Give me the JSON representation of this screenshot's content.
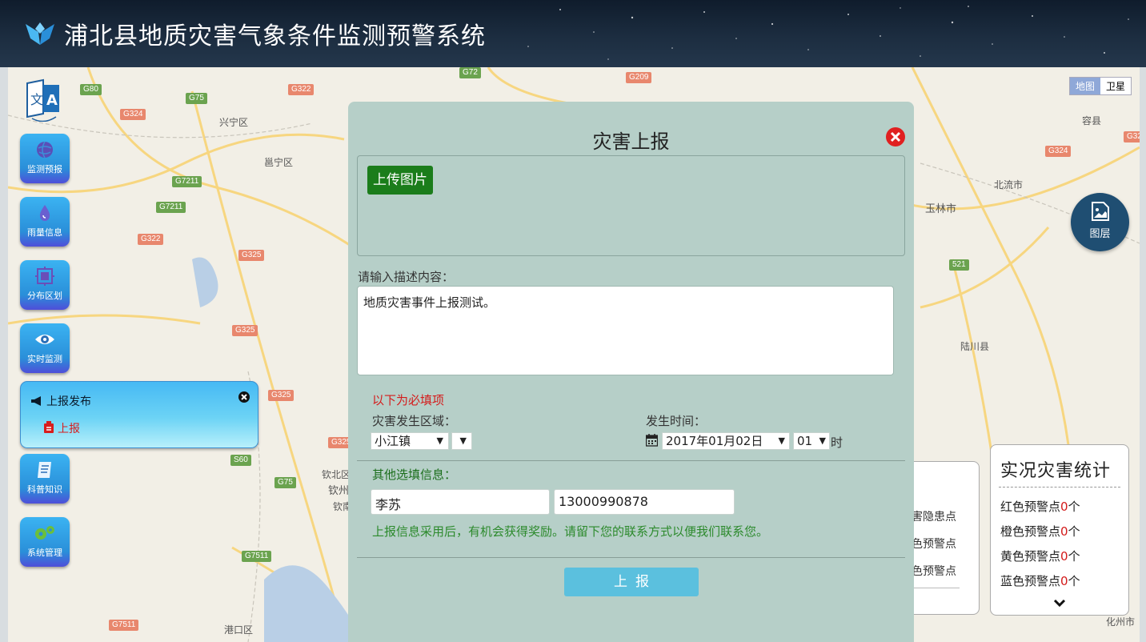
{
  "header": {
    "title": "浦北县地质灾害气象条件监测预警系统"
  },
  "map_type": {
    "map": "地图",
    "satellite": "卫星"
  },
  "map_labels": {
    "places": [
      "兴宁区",
      "邕宁区",
      "玉林市",
      "北流市",
      "容县",
      "陆川县",
      "钦北区",
      "钦州",
      "港口区",
      "化州市",
      "钦南"
    ],
    "roads": [
      "G80",
      "G75",
      "G322",
      "G324",
      "G7211",
      "G7211",
      "G322",
      "G325",
      "G325",
      "G325",
      "G72",
      "G209",
      "G324",
      "521",
      "S60",
      "G75",
      "G7511",
      "G7511",
      "G32",
      "G325"
    ]
  },
  "toolbar": {
    "items": [
      {
        "label": "监测预报",
        "icon": "globe-icon"
      },
      {
        "label": "雨量信息",
        "icon": "water-drop-icon"
      },
      {
        "label": "分布区划",
        "icon": "region-icon"
      },
      {
        "label": "实时监测",
        "icon": "eye-icon"
      },
      {
        "label": "科普知识",
        "icon": "book-icon"
      },
      {
        "label": "系统管理",
        "icon": "gears-icon"
      }
    ]
  },
  "report_panel": {
    "title": "上报发布",
    "item": "上报"
  },
  "layer_button": {
    "label": "图层"
  },
  "stats_back": {
    "rows": [
      "灾害隐患点",
      "橙色预警点",
      "蓝色预警点"
    ]
  },
  "stats": {
    "title": "实况灾害统计",
    "rows": [
      {
        "label": "红色预警点",
        "count": "0",
        "unit": "个"
      },
      {
        "label": "橙色预警点",
        "count": "0",
        "unit": "个"
      },
      {
        "label": "黄色预警点",
        "count": "0",
        "unit": "个"
      },
      {
        "label": "蓝色预警点",
        "count": "0",
        "unit": "个"
      }
    ]
  },
  "modal": {
    "title": "灾害上报",
    "upload_button": "上传图片",
    "desc_label": "请输入描述内容：",
    "desc_value": "地质灾害事件上报测试。",
    "required_label": "以下为必填项",
    "area_label": "灾害发生区域：",
    "area_value": "小江镇",
    "area_sub_value": "",
    "time_label": "发生时间：",
    "date_value": "2017年01月02日",
    "hour_value": "01",
    "hour_unit": "时",
    "other_label": "其他选填信息：",
    "name_value": "李苏",
    "phone_value": "13000990878",
    "reward_text": "上报信息采用后，有机会获得奖励。请留下您的联系方式以便我们联系您。",
    "submit_label": "上报"
  }
}
